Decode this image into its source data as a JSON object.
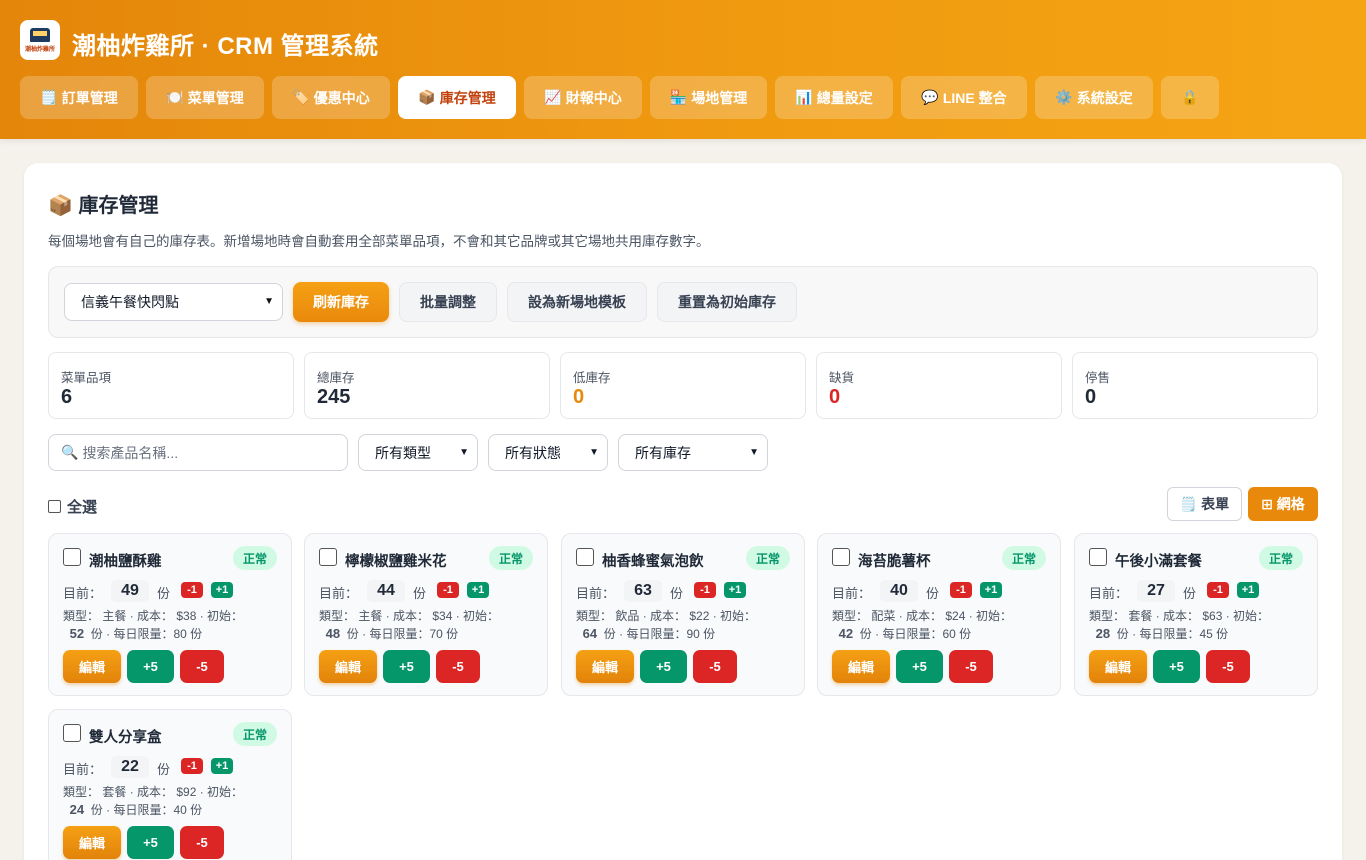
{
  "header": {
    "title": "潮柚炸雞所 · CRM 管理系統",
    "logo_text": "潮柚炸雞所",
    "tabs": [
      {
        "icon": "🗒️",
        "label": "訂單管理",
        "active": false
      },
      {
        "icon": "🍽️",
        "label": "菜單管理",
        "active": false
      },
      {
        "icon": "🏷️",
        "label": "優惠中心",
        "active": false
      },
      {
        "icon": "📦",
        "label": "庫存管理",
        "active": true
      },
      {
        "icon": "📈",
        "label": "財報中心",
        "active": false
      },
      {
        "icon": "🏪",
        "label": "場地管理",
        "active": false
      },
      {
        "icon": "📊",
        "label": "總量設定",
        "active": false
      },
      {
        "icon": "💬",
        "label": "LINE 整合",
        "active": false
      },
      {
        "icon": "⚙️",
        "label": "系統設定",
        "active": false
      },
      {
        "icon": "🔒",
        "label": "",
        "active": false
      }
    ]
  },
  "page": {
    "title": "📦 庫存管理",
    "description": "每個場地會有自己的庫存表。新增場地時會自動套用全部菜單品項，不會和其它品牌或其它場地共用庫存數字。"
  },
  "toolbar": {
    "site_selected": "信義午餐快閃點",
    "refresh": "刷新庫存",
    "batch": "批量調整",
    "template": "設為新場地模板",
    "reset": "重置為初始庫存"
  },
  "stats": [
    {
      "label": "菜單品項",
      "value": "6",
      "color": "#1f2937"
    },
    {
      "label": "總庫存",
      "value": "245",
      "color": "#1f2937"
    },
    {
      "label": "低庫存",
      "value": "0",
      "color": "#e9890c"
    },
    {
      "label": "缺貨",
      "value": "0",
      "color": "#dc2626"
    },
    {
      "label": "停售",
      "value": "0",
      "color": "#1f2937"
    }
  ],
  "filters": {
    "search_placeholder": "搜索產品名稱...",
    "type": "所有類型",
    "status": "所有狀態",
    "stock": "所有庫存"
  },
  "select_all": "全選",
  "view": {
    "list": "🗒️ 表單",
    "grid": "⊞ 網格"
  },
  "labels": {
    "current": "目前：",
    "unit": "份",
    "minus1": "-1",
    "plus1": "+1",
    "edit": "編輯",
    "plus5": "+5",
    "minus5": "-5"
  },
  "items": [
    {
      "name": "潮柚鹽酥雞",
      "status": "正常",
      "current": "49",
      "type": "主餐",
      "cost": "$38",
      "initial": "52",
      "daily_limit": "80"
    },
    {
      "name": "檸檬椒鹽雞米花",
      "status": "正常",
      "current": "44",
      "type": "主餐",
      "cost": "$34",
      "initial": "48",
      "daily_limit": "70"
    },
    {
      "name": "柚香蜂蜜氣泡飲",
      "status": "正常",
      "current": "63",
      "type": "飲品",
      "cost": "$22",
      "initial": "64",
      "daily_limit": "90"
    },
    {
      "name": "海苔脆薯杯",
      "status": "正常",
      "current": "40",
      "type": "配菜",
      "cost": "$24",
      "initial": "42",
      "daily_limit": "60"
    },
    {
      "name": "午後小滿套餐",
      "status": "正常",
      "current": "27",
      "type": "套餐",
      "cost": "$63",
      "initial": "28",
      "daily_limit": "45"
    },
    {
      "name": "雙人分享盒",
      "status": "正常",
      "current": "22",
      "type": "套餐",
      "cost": "$92",
      "initial": "24",
      "daily_limit": "40"
    }
  ]
}
